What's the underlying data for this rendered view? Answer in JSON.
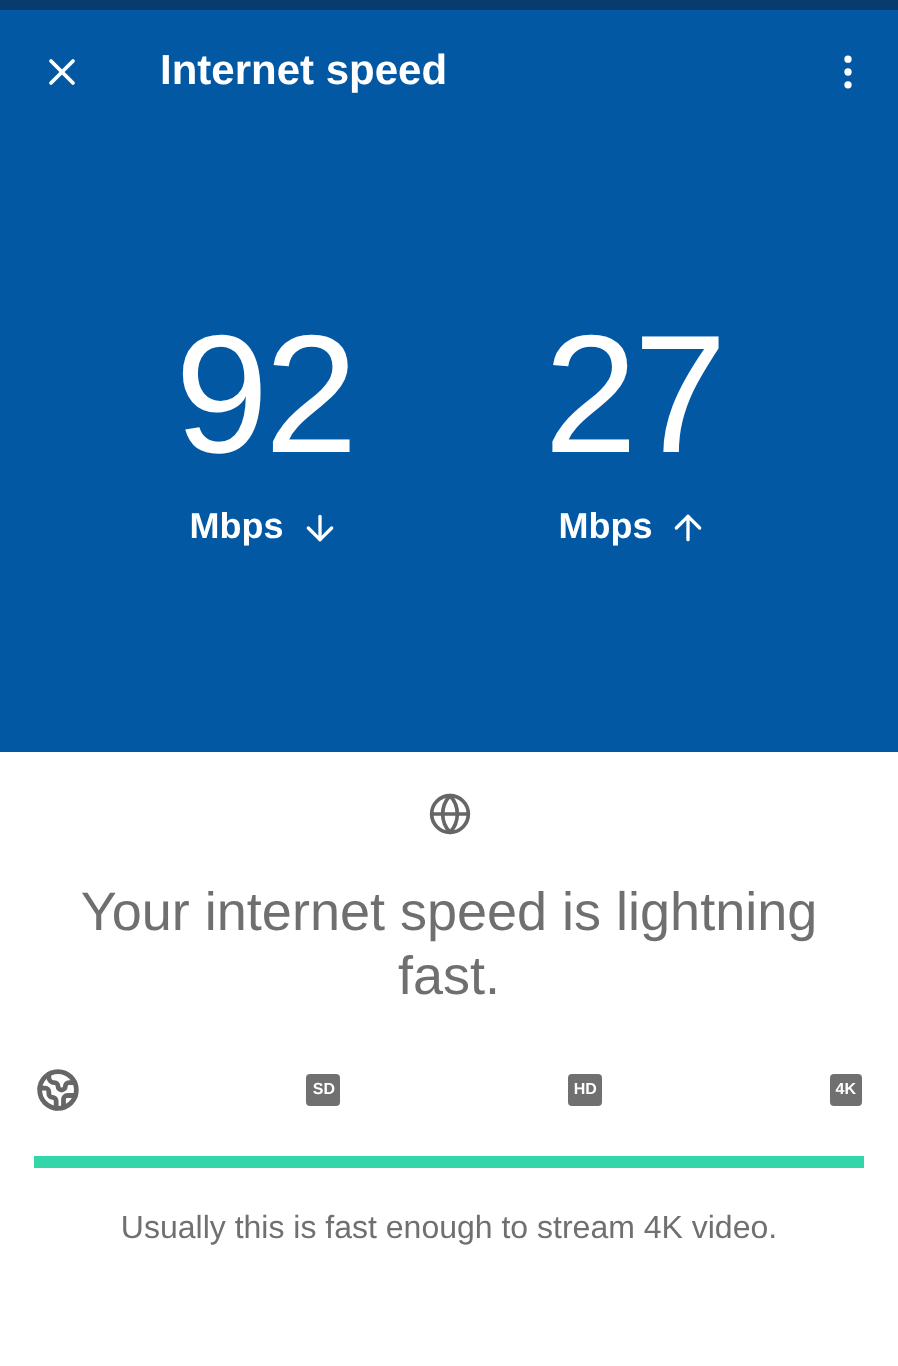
{
  "toolbar": {
    "title": "Internet speed"
  },
  "speeds": [
    {
      "value": "92",
      "unit": "Mbps",
      "kind": "down"
    },
    {
      "value": "27",
      "unit": "Mbps",
      "kind": "up"
    }
  ],
  "result": {
    "message": "Your internet speed is lightning fast.",
    "scale": [
      {
        "kind": "globe"
      },
      {
        "kind": "badge",
        "label": "SD"
      },
      {
        "kind": "badge",
        "label": "HD"
      },
      {
        "kind": "badge",
        "label": "4K"
      }
    ],
    "level": 1,
    "caption": "Usually this is fast enough to stream 4K video."
  }
}
